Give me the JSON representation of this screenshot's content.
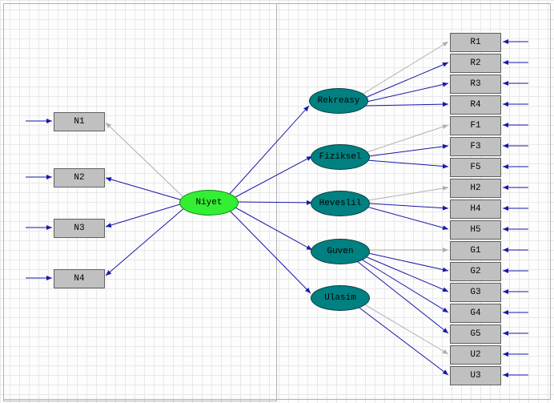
{
  "center": {
    "label": "Niyet"
  },
  "latents": [
    {
      "key": "rekreasy",
      "label": "Rekreasy"
    },
    {
      "key": "fiziksel",
      "label": "Fiziksel"
    },
    {
      "key": "heveslil",
      "label": "Heveslil"
    },
    {
      "key": "guven",
      "label": "Guven"
    },
    {
      "key": "ulasim",
      "label": "Ulasim"
    }
  ],
  "left_indicators": [
    {
      "key": "n1",
      "label": "N1"
    },
    {
      "key": "n2",
      "label": "N2"
    },
    {
      "key": "n3",
      "label": "N3"
    },
    {
      "key": "n4",
      "label": "N4"
    }
  ],
  "right_indicators": [
    {
      "key": "r1",
      "label": "R1"
    },
    {
      "key": "r2",
      "label": "R2"
    },
    {
      "key": "r3",
      "label": "R3"
    },
    {
      "key": "r4",
      "label": "R4"
    },
    {
      "key": "f1",
      "label": "F1"
    },
    {
      "key": "f3",
      "label": "F3"
    },
    {
      "key": "f5",
      "label": "F5"
    },
    {
      "key": "h2",
      "label": "H2"
    },
    {
      "key": "h4",
      "label": "H4"
    },
    {
      "key": "h5",
      "label": "H5"
    },
    {
      "key": "g1",
      "label": "G1"
    },
    {
      "key": "g2",
      "label": "G2"
    },
    {
      "key": "g3",
      "label": "G3"
    },
    {
      "key": "g4",
      "label": "G4"
    },
    {
      "key": "g5",
      "label": "G5"
    },
    {
      "key": "u2",
      "label": "U2"
    },
    {
      "key": "u3",
      "label": "U3"
    }
  ],
  "colors": {
    "arrow": "#1818aa",
    "arrow_light": "#b0b0b0",
    "rect_fill": "#c0c0c0",
    "latent_fill": "#008080",
    "center_fill": "#33ee33"
  }
}
